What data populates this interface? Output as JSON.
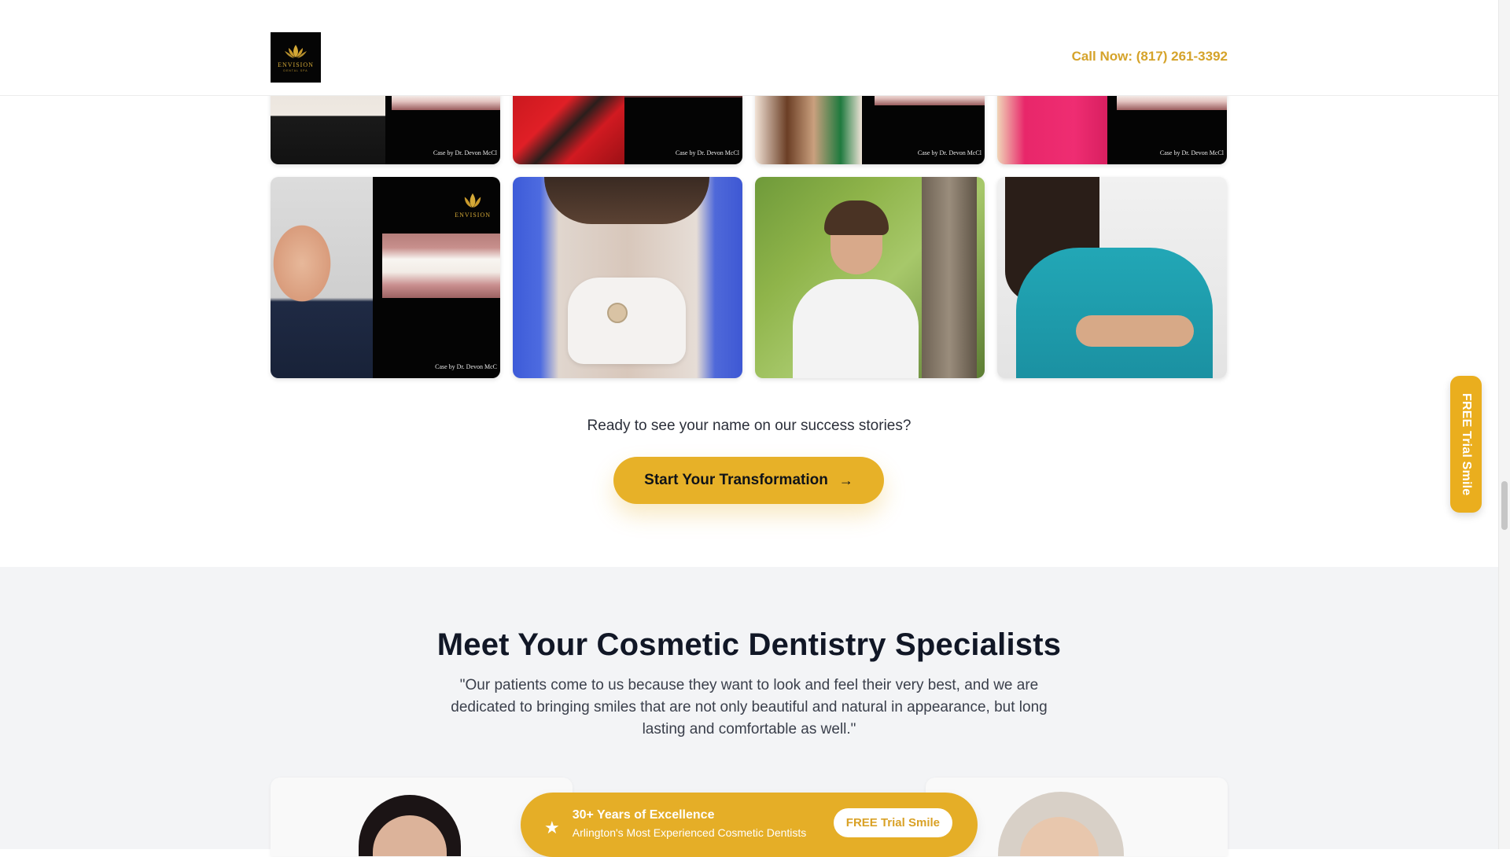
{
  "header": {
    "logo_text": "ENVISION",
    "logo_sub": "DENTAL SPA",
    "call_now": "Call Now: (817) 261-3392"
  },
  "gallery": {
    "row_top": [
      {
        "type": "before-after",
        "caption": "Case by Dr. Devon McCl"
      },
      {
        "type": "before-after",
        "caption": "Case by Dr. Devon McCl"
      },
      {
        "type": "before-after",
        "caption": "Case by Dr. Devon McCl"
      },
      {
        "type": "before-after",
        "caption": "Case by Dr. Devon McCl"
      }
    ],
    "row_bottom": [
      {
        "type": "before-after",
        "caption": "Case by Dr. Devon McC",
        "logo": "ENVISION"
      },
      {
        "type": "photo",
        "alt": "dentist with mask and tools"
      },
      {
        "type": "photo",
        "alt": "doctor in white coat outdoors"
      },
      {
        "type": "photo",
        "alt": "doctor in teal scrubs"
      }
    ]
  },
  "cta": {
    "text": "Ready to see your name on our success stories?",
    "button_label": "Start Your Transformation",
    "arrow": "→"
  },
  "specialists": {
    "title": "Meet Your Cosmetic Dentistry Specialists",
    "quote": "\"Our patients come to us because they want to look and feel their very best, and we are dedicated to bringing smiles that are not only beautiful and natural in appearance, but long lasting and comfortable as well.\"",
    "badge": {
      "star": "★",
      "title": "30+ Years of Excellence",
      "subtitle": "Arlington's Most Experienced Cosmetic Dentists",
      "button_label": "FREE Trial Smile"
    }
  },
  "side_tab": {
    "label": "FREE Trial Smile"
  },
  "colors": {
    "accent": "#e7b128",
    "call_now": "#d5a32a",
    "section_bg": "#f3f4f6"
  }
}
